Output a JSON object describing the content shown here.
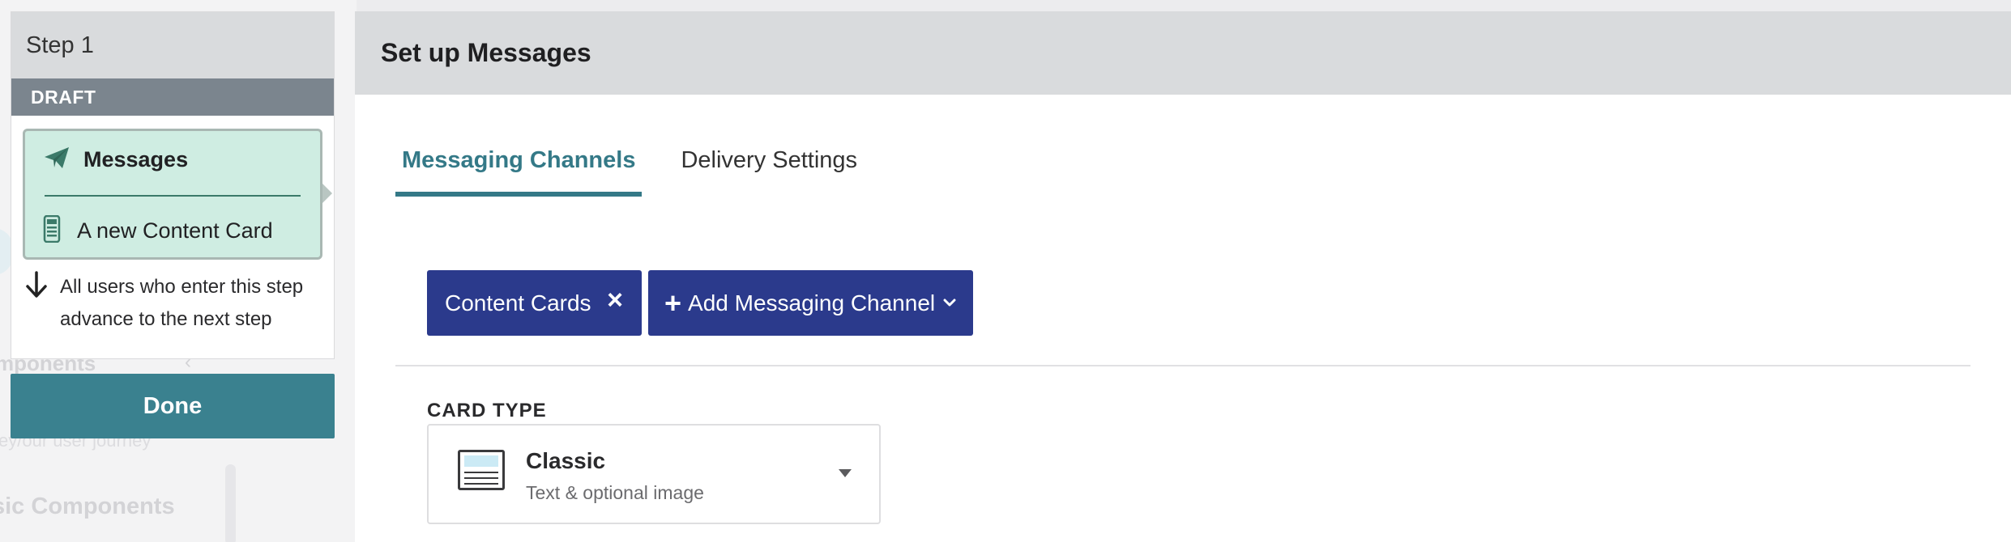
{
  "background": {
    "components_label": "mponents",
    "subtitle": "ey/our user journey",
    "basic_label": "sic Components",
    "chevron": "‹"
  },
  "step": {
    "title": "Step 1",
    "status_badge": "DRAFT",
    "messages_label": "Messages",
    "content_card_label": "A new Content Card",
    "advance_text": "All users who enter this step advance to the next step"
  },
  "done_label": "Done",
  "modal": {
    "title": "Set up Messages",
    "tabs": [
      {
        "label": "Messaging Channels",
        "active": true
      },
      {
        "label": "Delivery Settings",
        "active": false
      }
    ],
    "channels": [
      {
        "label": "Content Cards"
      }
    ],
    "add_channel_label": "Add Messaging Channel",
    "card_type": {
      "section_label": "CARD TYPE",
      "selected_title": "Classic",
      "selected_description": "Text & optional image"
    }
  },
  "colors": {
    "accent_teal": "#347987",
    "primary_navy": "#2b3a8c",
    "draft_gray": "#7b858e",
    "message_green": "#cfede2"
  },
  "icons": {
    "messages": "paper-plane-icon",
    "content_card": "phone-card-icon",
    "advance": "arrow-down-icon",
    "remove": "close-icon",
    "add": "plus-icon",
    "dropdown": "chevron-down-icon",
    "card_type": "classic-card-icon",
    "select_caret": "caret-down-icon"
  }
}
